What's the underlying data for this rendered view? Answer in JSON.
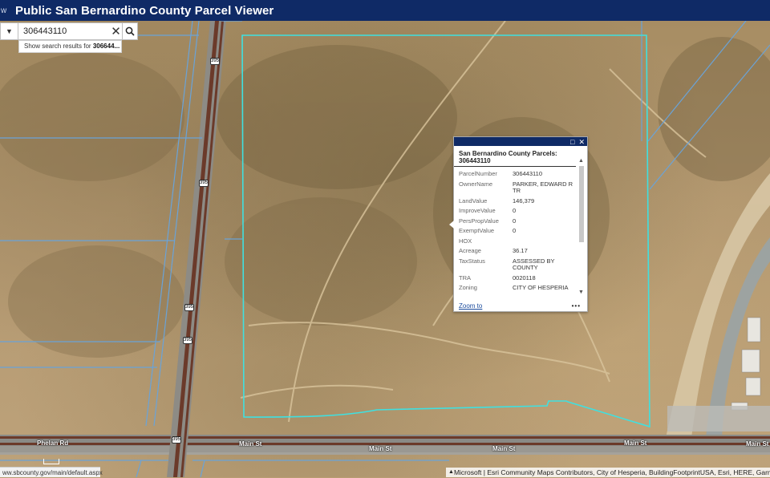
{
  "app": {
    "title": "Public San Bernardino County Parcel Viewer",
    "menu_glyph": "w"
  },
  "search": {
    "value": "306443110",
    "suggestion_prefix": "Show search results for",
    "suggestion_term": "306644...",
    "dropdown_icon": "caret-down-icon",
    "clear_icon": "close-icon",
    "search_icon": "search-icon"
  },
  "popup": {
    "title": "San Bernardino County Parcels: 306443110",
    "fields": [
      {
        "key": "ParcelNumber",
        "value": "306443110"
      },
      {
        "key": "OwnerName",
        "value": "PARKER, EDWARD R TR"
      },
      {
        "key": "LandValue",
        "value": "146,379"
      },
      {
        "key": "ImproveValue",
        "value": "0"
      },
      {
        "key": "PersPropValue",
        "value": "0"
      },
      {
        "key": "ExemptValue",
        "value": "0"
      },
      {
        "key": "HOX",
        "value": ""
      },
      {
        "key": "Acreage",
        "value": "36.17"
      },
      {
        "key": "TaxStatus",
        "value": "ASSESSED BY COUNTY"
      },
      {
        "key": "TRA",
        "value": "0020118"
      },
      {
        "key": "Zoning",
        "value": "CITY OF HESPERIA"
      }
    ],
    "zoom_label": "Zoom to",
    "more_label": "•••",
    "maximize_icon": "maximize-icon",
    "close_icon": "close-icon"
  },
  "map_labels": {
    "phelan_rd": "Phelan Rd",
    "main_st_1": "Main St",
    "main_st_2": "Main St",
    "main_st_3": "Main St",
    "main_st_4": "Main St",
    "main_st_5": "Main St",
    "shield": "395"
  },
  "status_url": "ww.sbcounty.gov/main/default.aspx",
  "attribution": "Microsoft | Esri Community Maps Contributors, City of Hesperia, BuildingFootprintUSA, Esri, HERE, Garmin",
  "colors": {
    "header": "#0f2a66",
    "parcel_highlight": "#3fe0e0",
    "parcel_lines": "#6aa3d8",
    "road": "#6b3a2a"
  }
}
